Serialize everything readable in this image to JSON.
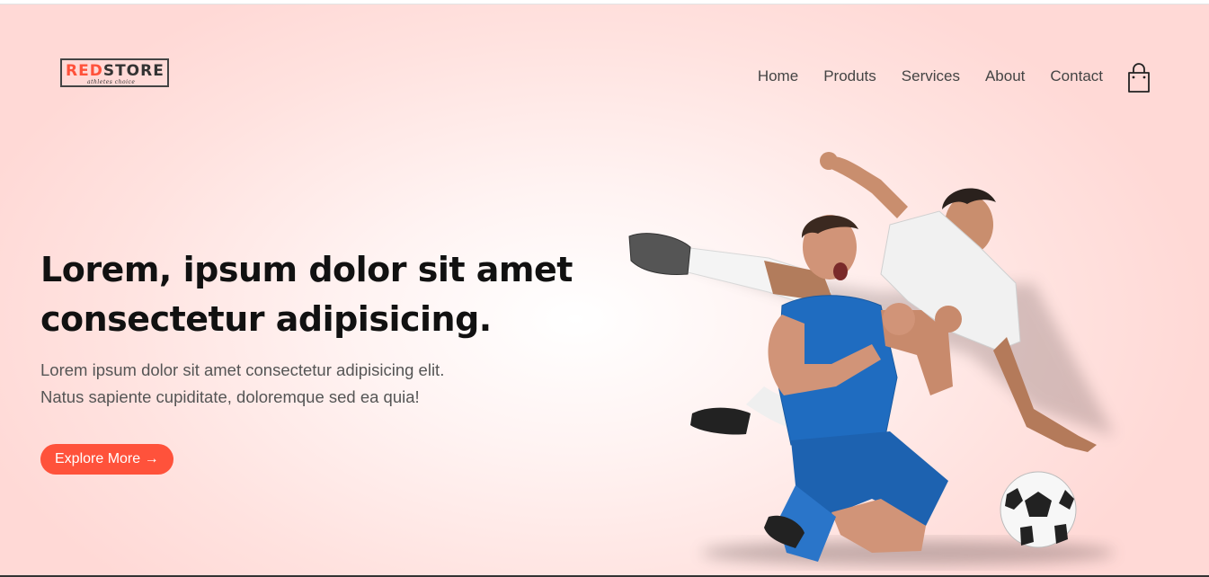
{
  "brand": {
    "logo_prefix": "RED",
    "logo_suffix": "STORE",
    "tagline": "athletes choice",
    "accent_color": "#ff523b"
  },
  "nav": {
    "items": [
      "Home",
      "Produts",
      "Services",
      "About",
      "Contact"
    ],
    "cart_icon": "shopping-bag-icon"
  },
  "hero": {
    "title_line1": "Lorem, ipsum dolor sit amet",
    "title_line2": "consectetur adipisicing.",
    "text_line1": "Lorem ipsum dolor sit amet consectetur adipisicing elit.",
    "text_line2": "Natus sapiente cupiditate, doloremque sed ea quia!",
    "button_label": "Explore More →",
    "image_name": "football-players-image"
  }
}
